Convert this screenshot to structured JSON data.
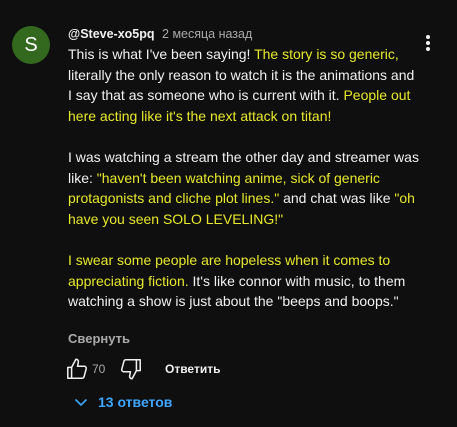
{
  "comment": {
    "avatar_letter": "S",
    "avatar_color": "#33691e",
    "author": "@Steve-xo5pq",
    "timestamp": "2 месяца назад",
    "menu_icon": "more-vert-icon",
    "paragraph1": {
      "part1": "This is what I've been saying! ",
      "part2": "The story is so generic,",
      "part3": " literally the only reason to watch it is the animations and I say that as someone who is current with it. ",
      "part4": "People out here acting like it's the next attack on titan!"
    },
    "paragraph2": {
      "part1": "I was watching a stream the other day and streamer was like: ",
      "part2": "\"haven't been watching anime, sick of generic protagonists and cliche plot lines.\"",
      "part3": " and chat was like ",
      "part4": "\"oh have you seen SOLO LEVELING!\""
    },
    "paragraph3": {
      "part1": "I swear some people are hopeless when it comes to appreciating fiction.",
      "part2": " It's like connor with music, to them watching a show is just about the \"beeps and boops.\""
    },
    "highlight_color": "#e8e92c",
    "collapse_label": "Свернуть",
    "like_count": "70",
    "reply_label": "Ответить",
    "replies_label": "13 ответов",
    "replies_color": "#3ea6ff"
  }
}
